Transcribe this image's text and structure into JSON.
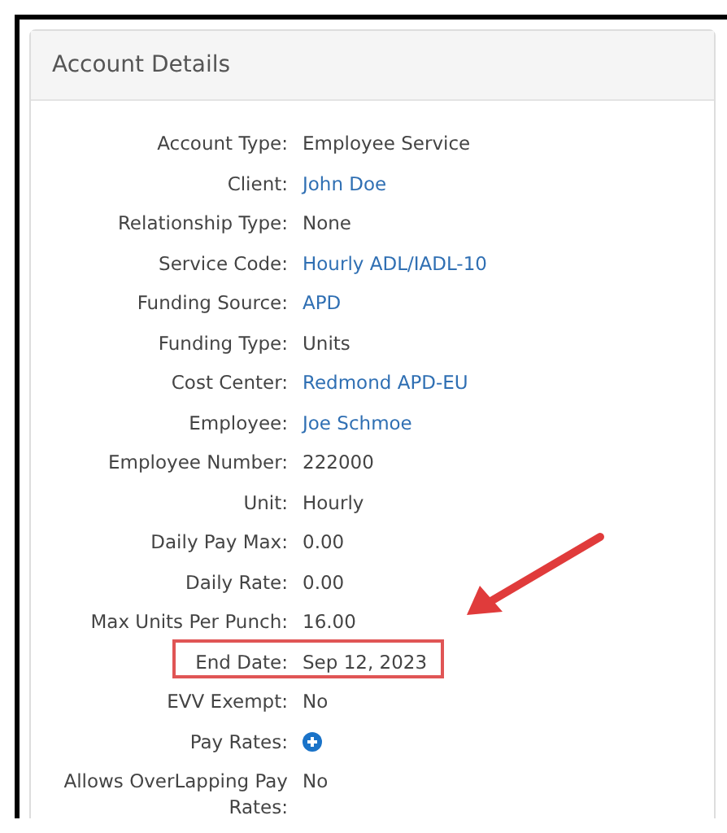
{
  "panel": {
    "title": "Account Details"
  },
  "rows": [
    {
      "label": "Account Type:",
      "kind": "text",
      "value": "Employee Service",
      "highlighted": false
    },
    {
      "label": "Client:",
      "kind": "link",
      "value": "John Doe",
      "highlighted": false
    },
    {
      "label": "Relationship Type:",
      "kind": "text",
      "value": "None",
      "highlighted": false
    },
    {
      "label": "Service Code:",
      "kind": "link",
      "value": "Hourly ADL/IADL-10",
      "highlighted": false
    },
    {
      "label": "Funding Source:",
      "kind": "link",
      "value": "APD",
      "highlighted": false
    },
    {
      "label": "Funding Type:",
      "kind": "text",
      "value": "Units",
      "highlighted": false
    },
    {
      "label": "Cost Center:",
      "kind": "link",
      "value": "Redmond APD-EU",
      "highlighted": false
    },
    {
      "label": "Employee:",
      "kind": "link",
      "value": "Joe Schmoe",
      "highlighted": false
    },
    {
      "label": "Employee Number:",
      "kind": "text",
      "value": "222000",
      "highlighted": false
    },
    {
      "label": "Unit:",
      "kind": "text",
      "value": "Hourly",
      "highlighted": false
    },
    {
      "label": "Daily Pay Max:",
      "kind": "text",
      "value": "0.00",
      "highlighted": false
    },
    {
      "label": "Daily Rate:",
      "kind": "text",
      "value": "0.00",
      "highlighted": false
    },
    {
      "label": "Max Units Per Punch:",
      "kind": "text",
      "value": "16.00",
      "highlighted": false
    },
    {
      "label": "End Date:",
      "kind": "text",
      "value": "Sep 12, 2023",
      "highlighted": true
    },
    {
      "label": "EVV Exempt:",
      "kind": "text",
      "value": "No",
      "highlighted": false
    },
    {
      "label": "Pay Rates:",
      "kind": "add",
      "highlighted": false
    },
    {
      "label": "Allows OverLapping Pay Rates:",
      "kind": "text",
      "value": "No",
      "highlighted": false
    }
  ]
}
